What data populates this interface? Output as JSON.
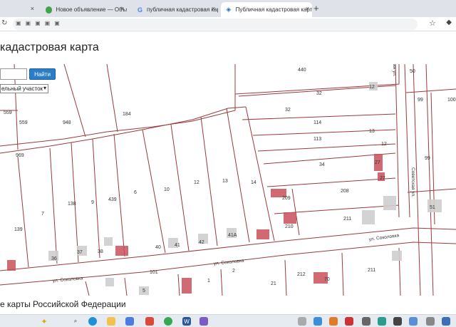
{
  "browser": {
    "tabs": [
      {
        "title": "",
        "active": false
      },
      {
        "title": "Новое объявление — Объяв",
        "active": false
      },
      {
        "title": "публичная кадастровая карта",
        "active": false
      },
      {
        "title": "Публичная кадастровая карта",
        "active": true
      }
    ],
    "new_tab": "+",
    "close": "×"
  },
  "page": {
    "heading": "кадастровая карта",
    "footer": "е карты Российской Федерации"
  },
  "search": {
    "button": "Найти",
    "select_value": "ельный участок"
  },
  "parcels": [
    "440",
    "50",
    "32",
    "99",
    "100",
    "32",
    "114",
    "13",
    "12",
    "113",
    "12",
    "184",
    "948",
    "559",
    "559",
    "969",
    "34",
    "99",
    "27",
    "27",
    "208",
    "209",
    "139",
    "7",
    "138",
    "9",
    "439",
    "6",
    "10",
    "12",
    "13",
    "14",
    "210",
    "211",
    "51",
    "41A",
    "36",
    "37",
    "38",
    "40",
    "41",
    "42",
    "101",
    "2",
    "212",
    "211",
    "1",
    "5",
    "70",
    "21"
  ],
  "streets": {
    "sokolovka_upper": "ул. Соколовка",
    "sokolovka_mid": "ул. Соколовка",
    "sokolovka_left": "ул. Соколовка",
    "sovetskaya": "Советская ул.",
    "sovetskaya_top": "ая ул."
  }
}
